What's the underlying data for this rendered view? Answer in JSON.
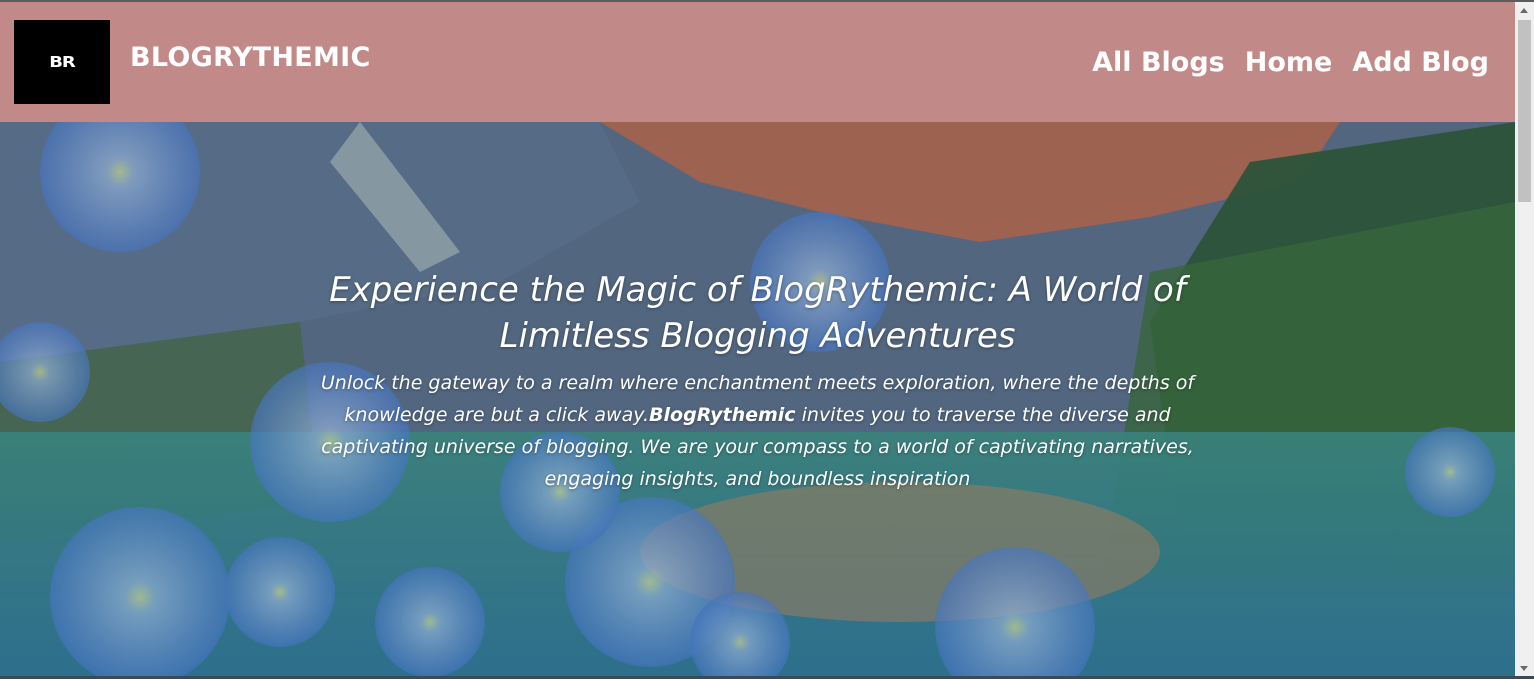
{
  "navbar": {
    "logo_text": "BR",
    "brand": "BLOGRYTHEMIC",
    "links": [
      {
        "label": "All Blogs"
      },
      {
        "label": "Home"
      },
      {
        "label": "Add Blog"
      }
    ],
    "background_color": "#c18a89"
  },
  "hero": {
    "title": "Experience the Magic of BlogRythemic: A World of Limitless Blogging Adventures",
    "description_part1": "Unlock the gateway to a realm where enchantment meets exploration, where the depths of knowledge are but a click away.",
    "description_bold": "BlogRythemic",
    "description_part2": " invites you to traverse the diverse and captivating universe of blogging. We are your compass to a world of captivating narratives, engaging insights, and boundless inspiration",
    "background_image": "mountain-lake-blue-flowers"
  }
}
